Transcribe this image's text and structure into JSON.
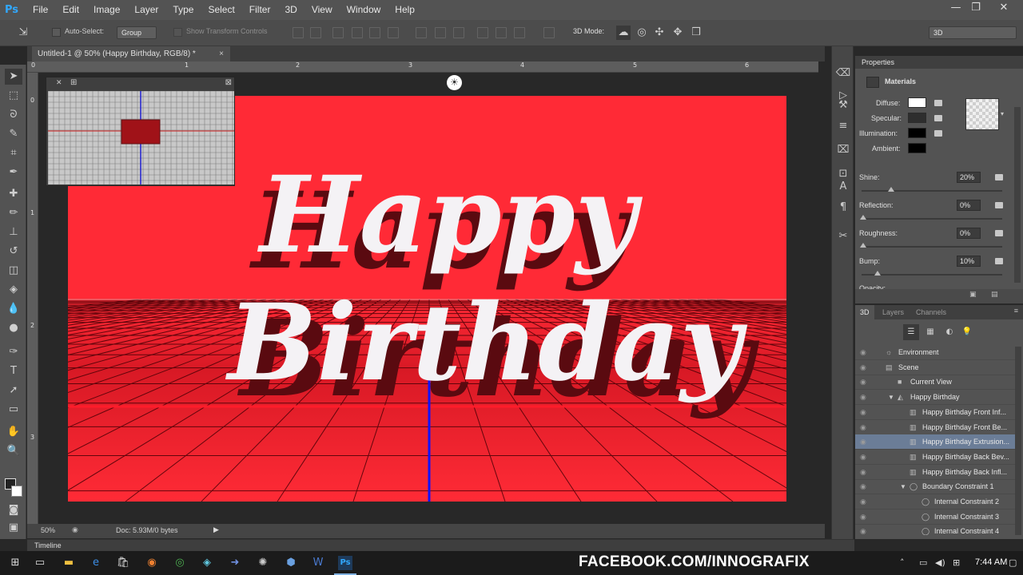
{
  "app": {
    "logo": "Ps"
  },
  "menu": [
    "File",
    "Edit",
    "Image",
    "Layer",
    "Type",
    "Select",
    "Filter",
    "3D",
    "View",
    "Window",
    "Help"
  ],
  "window_controls": {
    "minimize": "—",
    "restore": "❐",
    "close": "✕"
  },
  "options": {
    "auto_select_label": "Auto-Select:",
    "auto_select_value": "Group",
    "show_transform_label": "Show Transform Controls",
    "mode_3d_label": "3D Mode:",
    "workspace_value": "3D"
  },
  "document": {
    "tab_title": "Untitled-1 @ 50% (Happy  Birthday, RGB/8) *",
    "close": "×",
    "ruler_top": [
      "0",
      "1",
      "2",
      "3",
      "4",
      "5",
      "6"
    ],
    "ruler_left": [
      "0",
      "1",
      "2",
      "3"
    ],
    "artwork": {
      "line1": "Happy",
      "line2": "Birthday"
    }
  },
  "status": {
    "zoom": "50%",
    "doc_info": "Doc: 5.93M/0 bytes"
  },
  "timeline_label": "Timeline",
  "properties": {
    "panel_title": "Properties",
    "section": "Materials",
    "diffuse_label": "Diffuse:",
    "specular_label": "Specular:",
    "illumination_label": "Illumination:",
    "ambient_label": "Ambient:",
    "shine_label": "Shine:",
    "shine_value": "20%",
    "reflection_label": "Reflection:",
    "reflection_value": "0%",
    "roughness_label": "Roughness:",
    "roughness_value": "0%",
    "bump_label": "Bump:",
    "bump_value": "10%",
    "opacity_label": "Opacity:",
    "colors": {
      "diffuse": "#ffffff",
      "specular": "#2e2e2e",
      "illumination": "#000000",
      "ambient": "#000000"
    }
  },
  "scene_panel": {
    "tabs": [
      "3D",
      "Layers",
      "Channels"
    ],
    "tree": [
      {
        "label": "Environment",
        "indent": 0
      },
      {
        "label": "Scene",
        "indent": 0
      },
      {
        "label": "Current View",
        "indent": 1
      },
      {
        "label": "Happy  Birthday",
        "indent": 1
      },
      {
        "label": "Happy  Birthday Front Inf...",
        "indent": 2
      },
      {
        "label": "Happy  Birthday Front Be...",
        "indent": 2
      },
      {
        "label": "Happy  Birthday Extrusion...",
        "indent": 2,
        "selected": true
      },
      {
        "label": "Happy  Birthday Back Bev...",
        "indent": 2
      },
      {
        "label": "Happy  Birthday Back Infl...",
        "indent": 2
      },
      {
        "label": "Boundary Constraint 1",
        "indent": 2
      },
      {
        "label": "Internal Constraint 2",
        "indent": 3
      },
      {
        "label": "Internal Constraint 3",
        "indent": 3
      },
      {
        "label": "Internal Constraint 4",
        "indent": 3
      }
    ]
  },
  "taskbar": {
    "watermark": "FACEBOOK.COM/INNOGRAFIX",
    "time": "7:44 AM"
  }
}
